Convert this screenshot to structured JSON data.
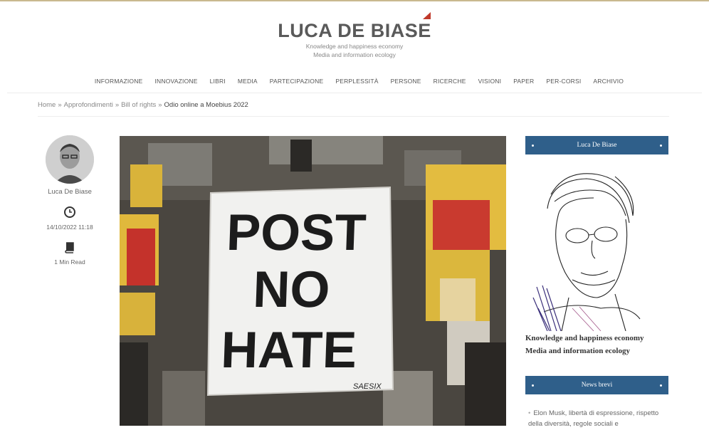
{
  "site": {
    "logo": "LUCA DE BIASE",
    "tagline_1": "Knowledge and happiness economy",
    "tagline_2": "Media and information ecology"
  },
  "nav": {
    "items": [
      "INFORMAZIONE",
      "INNOVAZIONE",
      "LIBRI",
      "MEDIA",
      "PARTECIPAZIONE",
      "PERPLESSITÀ",
      "PERSONE",
      "RICERCHE",
      "VISIONI",
      "PAPER",
      "PER-CORSI",
      "ARCHIVIO"
    ]
  },
  "breadcrumb": {
    "home": "Home",
    "level1": "Approfondimenti",
    "level2": "Bill of rights",
    "current": "Odio online a Moebius 2022",
    "separator": "»"
  },
  "meta": {
    "author": "Luca De Biase",
    "date": "14/10/2022 11:18",
    "read_time": "1 Min Read"
  },
  "hero": {
    "sign_line_1": "POST",
    "sign_line_2": "NO",
    "sign_line_3": "HATE",
    "signature": "SAESIX"
  },
  "sidebar": {
    "widget1_title": "Luca De Biase",
    "desc_line_1": "Knowledge and happiness economy",
    "desc_line_2": "Media and information ecology",
    "widget2_title": "News brevi",
    "news_item_1": "Elon Musk, libertà di espressione, rispetto della diversità, regole sociali e"
  },
  "colors": {
    "accent_bar": "#2f5f8a",
    "logo_flag": "#c0392b",
    "top_line": "#c9b98f"
  }
}
